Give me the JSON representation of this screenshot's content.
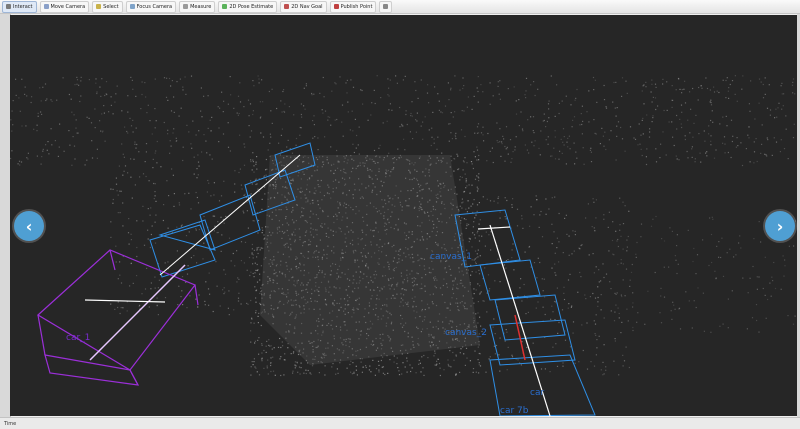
{
  "toolbar": {
    "buttons": [
      {
        "label": "Interact",
        "icon": "interact-icon",
        "color": "#7a7a7a"
      },
      {
        "label": "Move Camera",
        "icon": "move-camera-icon",
        "color": "#8aa0c8"
      },
      {
        "label": "Select",
        "icon": "select-icon",
        "color": "#c9b24a"
      },
      {
        "label": "Focus Camera",
        "icon": "focus-camera-icon",
        "color": "#7fa3c9"
      },
      {
        "label": "Measure",
        "icon": "measure-icon",
        "color": "#9a9a9a"
      },
      {
        "label": "2D Pose Estimate",
        "icon": "pose-estimate-icon",
        "color": "#5bb35b"
      },
      {
        "label": "2D Nav Goal",
        "icon": "nav-goal-icon",
        "color": "#c05050"
      },
      {
        "label": "Publish Point",
        "icon": "publish-point-icon",
        "color": "#c04040"
      }
    ]
  },
  "status": {
    "text": "Time"
  },
  "viewport": {
    "background": "#262626",
    "labels": [
      {
        "text": "car_1",
        "color": "#7a2bd0"
      },
      {
        "text": "canvas_1",
        "color": "#2a6fd0"
      },
      {
        "text": "canvas_2",
        "color": "#2a6fd0"
      },
      {
        "text": "car",
        "color": "#2a6fd0"
      },
      {
        "text": "car 7b",
        "color": "#2a6fd0"
      }
    ],
    "colors": {
      "blue_box": "#2f8fe6",
      "purple_box": "#9b2fd8",
      "points": "#c9c9c9"
    }
  },
  "nav": {
    "prev": "‹",
    "next": "›"
  }
}
